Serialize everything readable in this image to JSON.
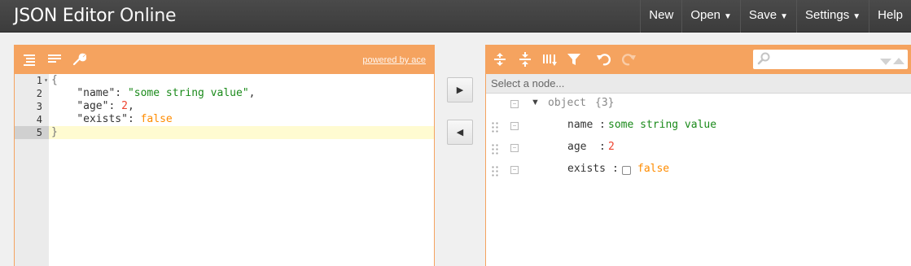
{
  "app": {
    "brand_bold": "JSON Editor",
    "brand_light": "Online"
  },
  "menu": {
    "new": "New",
    "open": "Open",
    "save": "Save",
    "settings": "Settings",
    "help": "Help",
    "caret": "▼"
  },
  "left_panel": {
    "toolbar_icons": [
      "format-icon",
      "compact-icon",
      "repair-icon"
    ],
    "powered_by": "powered by ace",
    "line_numbers": [
      "1",
      "2",
      "3",
      "4",
      "5"
    ],
    "code": {
      "open_brace": "{",
      "close_brace": "}",
      "lines": [
        {
          "key": "\"name\"",
          "colon": ": ",
          "value": "\"some string value\"",
          "trail": ",",
          "type": "string"
        },
        {
          "key": "\"age\"",
          "colon": ": ",
          "value": "2",
          "trail": ",",
          "type": "number"
        },
        {
          "key": "\"exists\"",
          "colon": ": ",
          "value": "false",
          "trail": "",
          "type": "boolean"
        }
      ]
    }
  },
  "transfer": {
    "to_right": "▶",
    "to_left": "◀"
  },
  "right_panel": {
    "toolbar_icons": [
      "expand-all-icon",
      "collapse-all-icon",
      "sort-icon",
      "filter-icon",
      "undo-icon",
      "redo-icon"
    ],
    "search": {
      "placeholder": "",
      "value": ""
    },
    "navbar_placeholder": "Select a node...",
    "root": {
      "label": "object",
      "count": "{3}"
    },
    "nodes": [
      {
        "field": "name",
        "separator": ":",
        "value": "some string value",
        "type": "string"
      },
      {
        "field": "age",
        "separator": ":",
        "value": "2",
        "type": "number"
      },
      {
        "field": "exists",
        "separator": ":",
        "value": "false",
        "type": "boolean"
      }
    ]
  },
  "colors": {
    "accent": "#f5a35f",
    "header": "#404040",
    "string": "#1a8a1a",
    "number": "#ee422e",
    "boolean": "#ff8c00"
  }
}
